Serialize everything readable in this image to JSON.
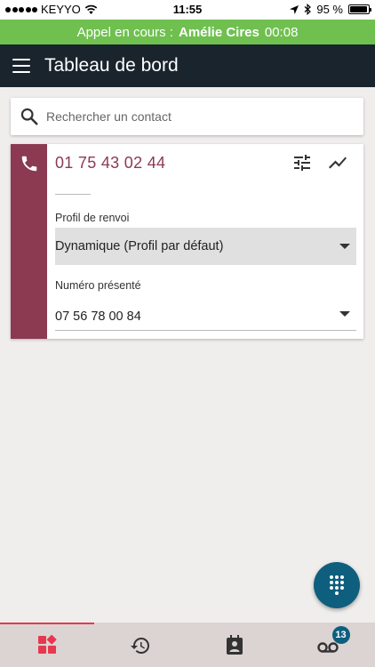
{
  "status_bar": {
    "carrier": "KEYYO",
    "time": "11:55",
    "battery_percent": "95 %",
    "battery_level": 0.95
  },
  "call_banner": {
    "prefix": "Appel en cours :",
    "contact_name": "Amélie Cires",
    "duration": "00:08",
    "color": "#6fc04f"
  },
  "app_bar": {
    "title": "Tableau de bord",
    "color": "#1a242d",
    "menu_icon": "hamburger-menu-icon"
  },
  "search": {
    "placeholder": "Rechercher un contact",
    "value": "",
    "icon": "search-icon"
  },
  "line_card": {
    "number": "01 75 43 02 44",
    "accent_color": "#8b3a52",
    "icons": [
      "phone-icon",
      "settings-sliders-icon",
      "stats-trend-icon"
    ],
    "forwarding_label": "Profil de renvoi",
    "forwarding_value": "Dynamique (Profil par défaut)",
    "presented_label": "Numéro présenté",
    "presented_value": "07 56 78 00 84"
  },
  "fab": {
    "icon": "dialpad-icon",
    "color": "#0e5f7e"
  },
  "bottom_nav": {
    "active_color": "#e63950",
    "tabs": [
      {
        "icon": "dashboard-icon",
        "active": true
      },
      {
        "icon": "history-icon",
        "active": false
      },
      {
        "icon": "contacts-icon",
        "active": false
      },
      {
        "icon": "voicemail-icon",
        "active": false,
        "badge": "13"
      }
    ]
  }
}
